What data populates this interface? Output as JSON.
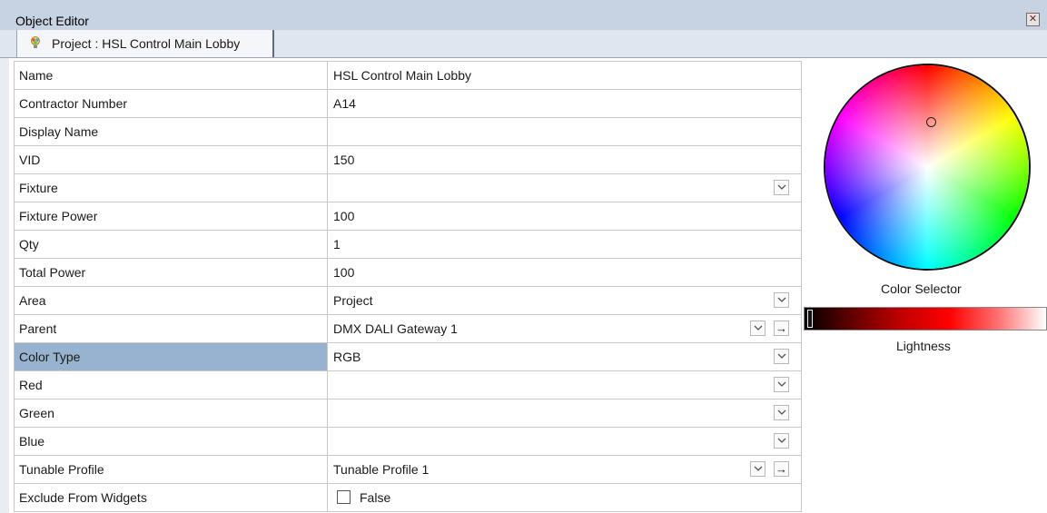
{
  "window": {
    "title": "Object Editor",
    "close_icon": "close-icon"
  },
  "tab": {
    "label": "Project : HSL Control Main Lobby",
    "icon": "bulb-icon"
  },
  "properties": [
    {
      "name": "Name",
      "value": "HSL Control Main Lobby",
      "dropdown": false,
      "navigate": false
    },
    {
      "name": "Contractor Number",
      "value": "A14",
      "dropdown": false,
      "navigate": false
    },
    {
      "name": "Display Name",
      "value": "",
      "dropdown": false,
      "navigate": false
    },
    {
      "name": "VID",
      "value": "150",
      "dropdown": false,
      "navigate": false
    },
    {
      "name": "Fixture",
      "value": "",
      "dropdown": true,
      "navigate": false
    },
    {
      "name": "Fixture Power",
      "value": "100",
      "dropdown": false,
      "navigate": false
    },
    {
      "name": "Qty",
      "value": "1",
      "dropdown": false,
      "navigate": false
    },
    {
      "name": "Total Power",
      "value": "100",
      "dropdown": false,
      "navigate": false
    },
    {
      "name": "Area",
      "value": "Project",
      "dropdown": true,
      "navigate": false
    },
    {
      "name": "Parent",
      "value": "DMX DALI Gateway 1",
      "dropdown": true,
      "navigate": true
    },
    {
      "name": "Color Type",
      "value": "RGB",
      "dropdown": true,
      "navigate": false,
      "selected": true
    },
    {
      "name": "Red",
      "value": "",
      "dropdown": true,
      "navigate": false
    },
    {
      "name": "Green",
      "value": "",
      "dropdown": true,
      "navigate": false
    },
    {
      "name": "Blue",
      "value": "",
      "dropdown": true,
      "navigate": false
    },
    {
      "name": "Tunable Profile",
      "value": "Tunable Profile 1",
      "dropdown": true,
      "navigate": true
    },
    {
      "name": "Exclude From Widgets",
      "value": "False",
      "checkbox": true,
      "checked": false
    }
  ],
  "color_selector": {
    "label": "Color Selector"
  },
  "lightness": {
    "label": "Lightness",
    "level": 0.01
  },
  "colors": {
    "title_bar": "#c7d3e3",
    "selected_row": "#98b3cf",
    "grid_border": "#c8c8c8"
  }
}
